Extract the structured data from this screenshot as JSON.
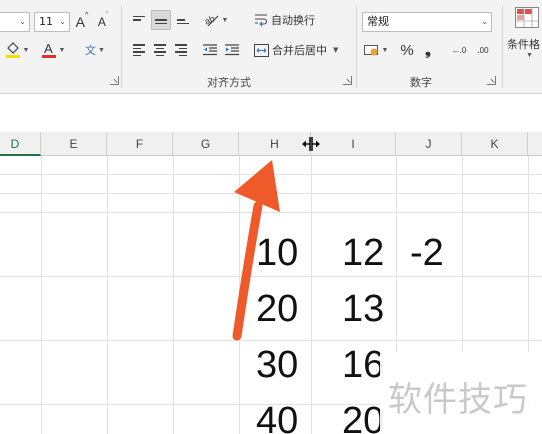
{
  "ribbon": {
    "font_size": "11",
    "grow_font_label": "A",
    "shrink_font_label": "A",
    "wen_label": "文",
    "wrap_text_label": "自动换行",
    "merge_center_label": "合并后居中",
    "alignment_group_label": "对齐方式",
    "number_format": "常规",
    "percent_label": "%",
    "comma_label": "❟",
    "inc_decimal_label": "←.0",
    "dec_decimal_label": ".00",
    "number_group_label": "数字",
    "conditional_format_label": "条件格",
    "font_color": "#e0312b",
    "fill_color": "#f2e000"
  },
  "grid": {
    "columns": [
      "D",
      "E",
      "F",
      "G",
      "H",
      "I",
      "J",
      "K"
    ],
    "rows": [
      {
        "h": "10",
        "i": "12",
        "j": "-2"
      },
      {
        "h": "20",
        "i": "13",
        "j": ""
      },
      {
        "h": "30",
        "i": "16",
        "j": ""
      },
      {
        "h": "40",
        "i": "20",
        "j": ""
      }
    ]
  },
  "annotation": {
    "arrow_color": "#ee5a2a"
  },
  "watermark": "软件技巧"
}
